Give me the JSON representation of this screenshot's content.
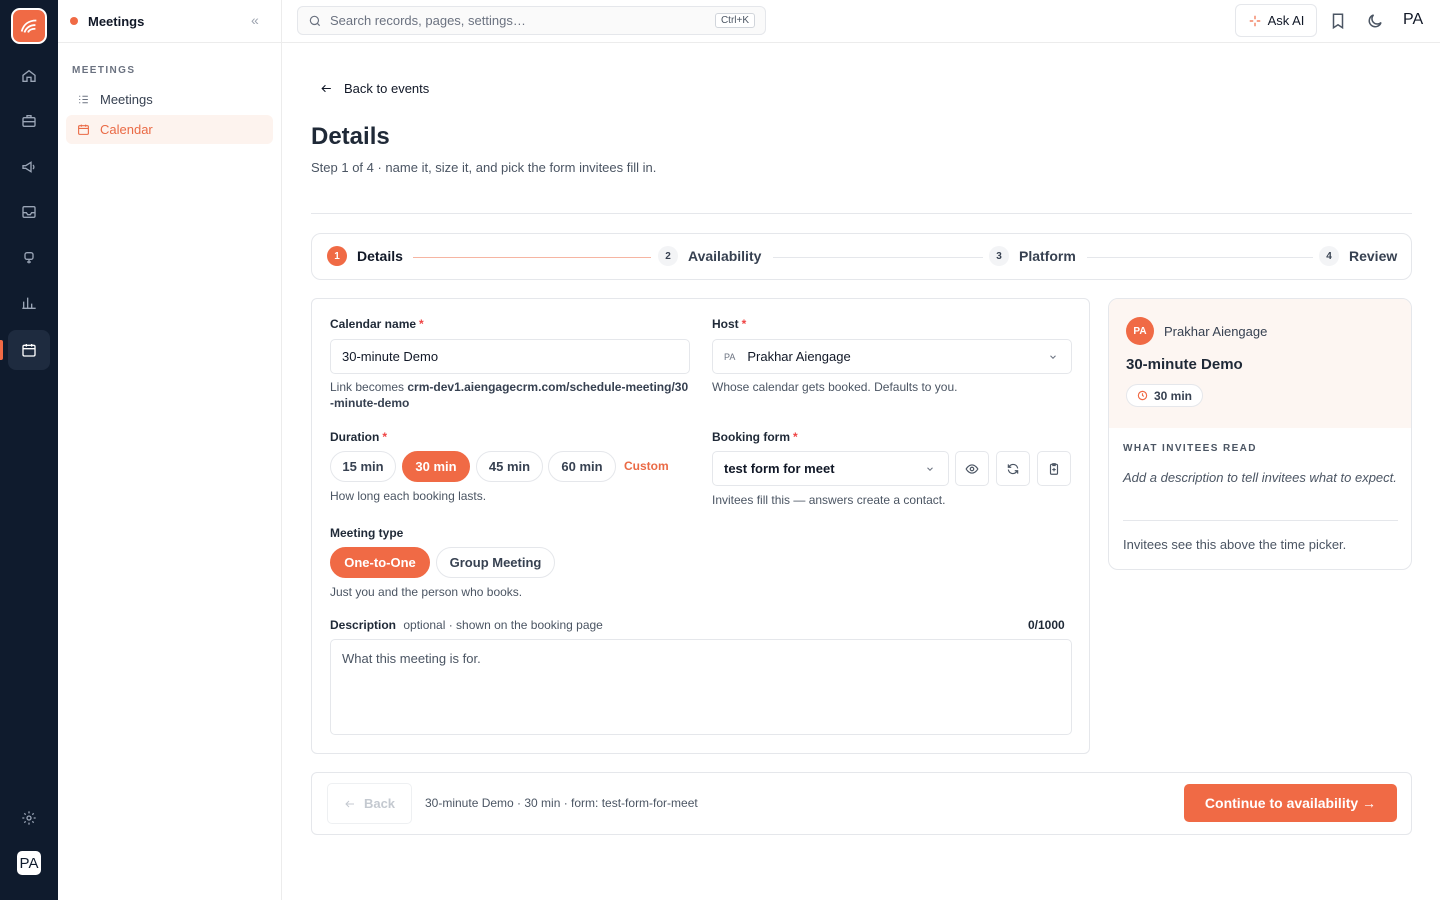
{
  "rail": {
    "items": [
      "home",
      "briefcase",
      "megaphone",
      "inbox",
      "robot",
      "chart",
      "calendar"
    ],
    "avatar": "PA"
  },
  "sidebar": {
    "title": "Meetings",
    "section": "MEETINGS",
    "items": [
      {
        "label": "Meetings"
      },
      {
        "label": "Calendar"
      }
    ]
  },
  "topbar": {
    "search_placeholder": "Search records, pages, settings…",
    "shortcut": "Ctrl+K",
    "ask_ai": "Ask AI",
    "user_initials": "PA"
  },
  "page": {
    "back_link": "Back to events",
    "title": "Details",
    "subtitle": "Step 1 of 4 · name it, size it, and pick the form invitees fill in."
  },
  "stepper": {
    "steps": [
      {
        "num": "1",
        "label": "Details"
      },
      {
        "num": "2",
        "label": "Availability"
      },
      {
        "num": "3",
        "label": "Platform"
      },
      {
        "num": "4",
        "label": "Review"
      }
    ]
  },
  "form": {
    "calendar_name": {
      "label": "Calendar name",
      "value": "30-minute Demo",
      "help_prefix": "Link becomes ",
      "help_link": "crm-dev1.aiengagecrm.com/schedule-meeting/30-minute-demo"
    },
    "host": {
      "label": "Host",
      "chip": "PA",
      "value": "Prakhar Aiengage",
      "help": "Whose calendar gets booked. Defaults to you."
    },
    "duration": {
      "label": "Duration",
      "options": [
        "15 min",
        "30 min",
        "45 min",
        "60 min"
      ],
      "custom": "Custom",
      "help": "How long each booking lasts."
    },
    "booking_form": {
      "label": "Booking form",
      "value": "test form for meet",
      "help": "Invitees fill this — answers create a contact."
    },
    "meeting_type": {
      "label": "Meeting type",
      "options": [
        "One-to-One",
        "Group Meeting"
      ],
      "help": "Just you and the person who books."
    },
    "description": {
      "label": "Description",
      "hint": "optional · shown on the booking page",
      "counter": "0/1000",
      "placeholder": "What this meeting is for."
    }
  },
  "preview": {
    "avatar": "PA",
    "host": "Prakhar Aiengage",
    "title": "30-minute Demo",
    "duration": "30 min",
    "section": "WHAT INVITEES READ",
    "description": "Add a description to tell invitees what to expect.",
    "footnote": "Invitees see this above the time picker."
  },
  "footer": {
    "back": "Back",
    "summary": "30-minute Demo · 30 min · form: test-form-for-meet",
    "continue": "Continue to availability →"
  },
  "colors": {
    "accent": "#f06a45",
    "rail": "#0f1b2d"
  }
}
